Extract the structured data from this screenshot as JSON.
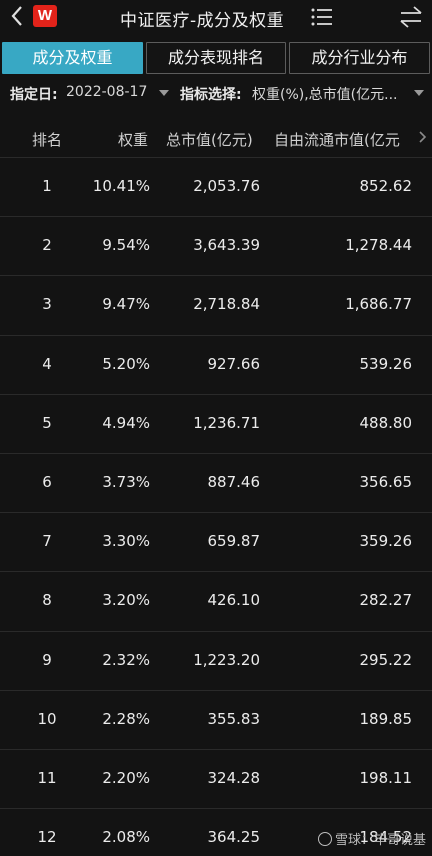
{
  "header": {
    "logo_text": "W",
    "title": "中证医疗-成分及权重"
  },
  "tabs": [
    {
      "label": "成分及权重",
      "active": true
    },
    {
      "label": "成分表现排名",
      "active": false
    },
    {
      "label": "成分行业分布",
      "active": false
    }
  ],
  "filter": {
    "date_label": "指定日:",
    "date_value": "2022-08-17",
    "indicator_label": "指标选择:",
    "indicator_value": "权重(%),总市值(亿元..."
  },
  "table": {
    "columns": [
      "排名",
      "权重",
      "总市值(亿元)",
      "自由流通市值(亿元"
    ],
    "rows": [
      {
        "rank": "1",
        "weight": "10.41%",
        "mcap": "2,053.76",
        "free": "852.62"
      },
      {
        "rank": "2",
        "weight": "9.54%",
        "mcap": "3,643.39",
        "free": "1,278.44"
      },
      {
        "rank": "3",
        "weight": "9.47%",
        "mcap": "2,718.84",
        "free": "1,686.77"
      },
      {
        "rank": "4",
        "weight": "5.20%",
        "mcap": "927.66",
        "free": "539.26"
      },
      {
        "rank": "5",
        "weight": "4.94%",
        "mcap": "1,236.71",
        "free": "488.80"
      },
      {
        "rank": "6",
        "weight": "3.73%",
        "mcap": "887.46",
        "free": "356.65"
      },
      {
        "rank": "7",
        "weight": "3.30%",
        "mcap": "659.87",
        "free": "359.26"
      },
      {
        "rank": "8",
        "weight": "3.20%",
        "mcap": "426.10",
        "free": "282.27"
      },
      {
        "rank": "9",
        "weight": "2.32%",
        "mcap": "1,223.20",
        "free": "295.22"
      },
      {
        "rank": "10",
        "weight": "2.28%",
        "mcap": "355.83",
        "free": "189.85"
      },
      {
        "rank": "11",
        "weight": "2.20%",
        "mcap": "324.28",
        "free": "198.11"
      },
      {
        "rank": "12",
        "weight": "2.08%",
        "mcap": "364.25",
        "free": "184.52"
      }
    ]
  },
  "watermark": {
    "text": "雪球：毕哥说基"
  },
  "colors": {
    "accent": "#38a8c4",
    "logo": "#e2231a",
    "background": "#131313"
  }
}
